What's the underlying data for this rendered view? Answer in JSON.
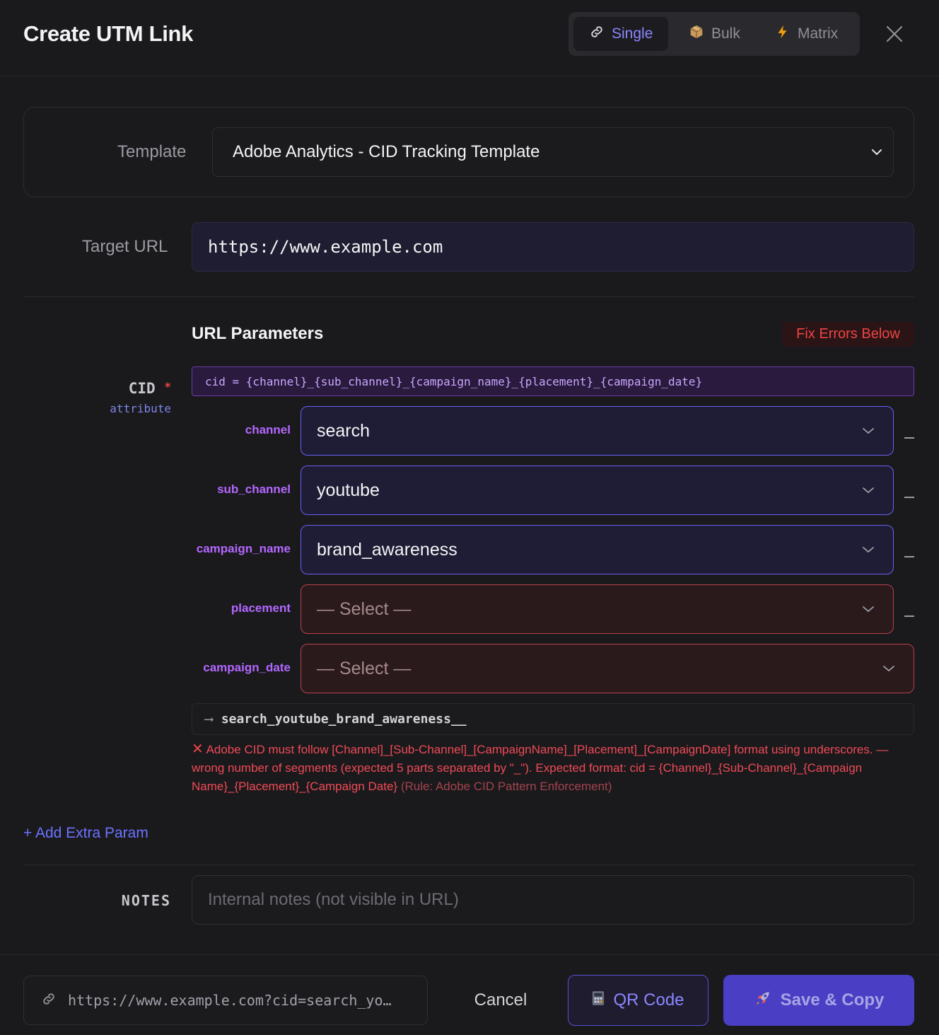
{
  "header": {
    "title": "Create UTM Link",
    "modes": [
      {
        "label": "Single",
        "icon": "link-icon",
        "active": true
      },
      {
        "label": "Bulk",
        "icon": "package-icon",
        "active": false
      },
      {
        "label": "Matrix",
        "icon": "lightning-icon",
        "active": false
      }
    ]
  },
  "template": {
    "label": "Template",
    "selected": "Adobe Analytics - CID Tracking Template"
  },
  "target_url": {
    "label": "Target URL",
    "value": "https://www.example.com"
  },
  "url_parameters": {
    "title": "URL Parameters",
    "error_badge": "Fix Errors Below",
    "cid": {
      "name": "CID",
      "required_marker": "*",
      "type": "attribute",
      "pattern": "cid = {channel}_{sub_channel}_{campaign_name}_{placement}_{campaign_date}",
      "segments": [
        {
          "label": "channel",
          "value": "search",
          "state": "ok"
        },
        {
          "label": "sub_channel",
          "value": "youtube",
          "state": "ok"
        },
        {
          "label": "campaign_name",
          "value": "brand_awareness",
          "state": "ok"
        },
        {
          "label": "placement",
          "value": "— Select —",
          "state": "error"
        },
        {
          "label": "campaign_date",
          "value": "— Select —",
          "state": "error"
        }
      ],
      "separator": "_",
      "preview_arrow": "⟶",
      "preview": "search_youtube_brand_awareness__",
      "error_icon": "✕",
      "error_message": "Adobe CID must follow [Channel]_[Sub-Channel]_[CampaignName]_[Placement]_[CampaignDate] format using underscores. — wrong number of segments (expected 5 parts separated by \"_\"). Expected format: cid = {Channel}_{Sub-Channel}_{Campaign Name}_{Placement}_{Campaign Date}",
      "error_rule": "(Rule: Adobe CID Pattern Enforcement)"
    },
    "add_extra": "+ Add Extra Param"
  },
  "notes": {
    "label": "NOTES",
    "placeholder": "Internal notes (not visible in URL)",
    "value": ""
  },
  "footer": {
    "final_url": "https://www.example.com?cid=search_yo…",
    "cancel": "Cancel",
    "qr": "QR Code",
    "save": "Save & Copy"
  },
  "colors": {
    "accent": "#8b86ff",
    "error": "#ef4444",
    "param_label": "#b467ff",
    "primary_button": "#4a3ec4"
  }
}
